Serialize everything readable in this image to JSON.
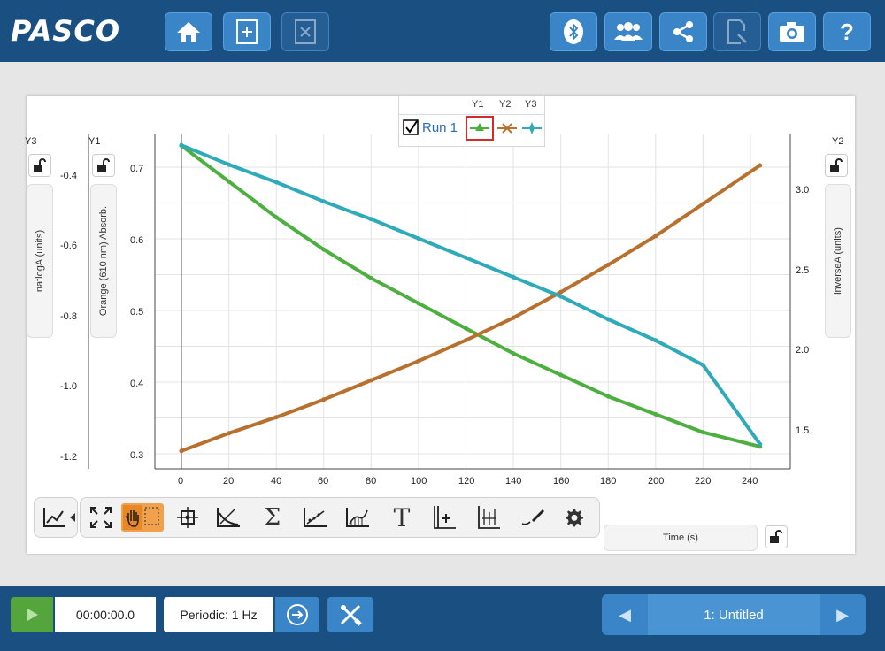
{
  "app": {
    "logo": "PASCO"
  },
  "toolbar_top": {
    "left_buttons": [
      "home-icon",
      "new-file-icon",
      "close-file-icon"
    ],
    "right_buttons": [
      "bluetooth-icon",
      "users-icon",
      "share-icon",
      "export-icon",
      "camera-icon",
      "help-icon"
    ],
    "help_glyph": "?"
  },
  "graph": {
    "legend": {
      "run_label": "Run 1",
      "headers": [
        "Y1",
        "Y2",
        "Y3"
      ],
      "checked": true
    },
    "axes": {
      "y3": {
        "tag": "Y3",
        "label": "natlogA (units)",
        "ticks": [
          "-0.4",
          "-0.6",
          "-0.8",
          "-1.0",
          "-1.2"
        ]
      },
      "y1": {
        "tag": "Y1",
        "label": "Orange (610 nm) Absorb.",
        "ticks": [
          "0.7",
          "0.6",
          "0.5",
          "0.4",
          "0.3"
        ]
      },
      "y2": {
        "tag": "Y2",
        "label": "inverseA (units)",
        "ticks": [
          "3.0",
          "2.5",
          "2.0",
          "1.5"
        ]
      },
      "x": {
        "label": "Time (s)",
        "ticks": [
          "0",
          "20",
          "40",
          "60",
          "80",
          "100",
          "120",
          "140",
          "160",
          "180",
          "200",
          "220",
          "240"
        ]
      }
    },
    "tools": [
      "graph-type-icon",
      "scale-to-fit-icon",
      "select-tool-icon",
      "coordinates-icon",
      "slope-icon",
      "statistics-icon",
      "curve-fit-icon",
      "area-icon",
      "annotation-icon",
      "add-axis-icon",
      "add-plot-icon",
      "draw-prediction-icon",
      "settings-icon"
    ],
    "annotation_glyph": "T",
    "stats_glyph": "Σ"
  },
  "chart_data": {
    "type": "line",
    "x_label": "Time (s)",
    "xlim": [
      0,
      245
    ],
    "series": [
      {
        "name": "Orange (610 nm) Absorb.",
        "axis": "Y1",
        "color": "#4caf3f",
        "x": [
          0,
          20,
          40,
          60,
          80,
          100,
          120,
          140,
          160,
          180,
          200,
          220,
          244
        ],
        "y": [
          0.73,
          0.68,
          0.63,
          0.585,
          0.545,
          0.51,
          0.475,
          0.44,
          0.41,
          0.38,
          0.355,
          0.33,
          0.31
        ]
      },
      {
        "name": "inverseA (units)",
        "axis": "Y2",
        "color": "#b8702e",
        "x": [
          0,
          20,
          40,
          60,
          80,
          100,
          120,
          140,
          160,
          180,
          200,
          220,
          244
        ],
        "y": [
          1.38,
          1.49,
          1.59,
          1.7,
          1.82,
          1.94,
          2.07,
          2.21,
          2.37,
          2.54,
          2.72,
          2.92,
          3.16
        ]
      },
      {
        "name": "natlogA (units)",
        "axis": "Y3",
        "color": "#2eaab9",
        "x": [
          0,
          20,
          40,
          60,
          80,
          100,
          120,
          140,
          160,
          180,
          200,
          220,
          244
        ],
        "y": [
          -0.31,
          -0.365,
          -0.415,
          -0.47,
          -0.52,
          -0.575,
          -0.63,
          -0.685,
          -0.74,
          -0.805,
          -0.865,
          -0.935,
          -1.16
        ]
      }
    ],
    "y1_range": [
      0.29,
      0.76
    ],
    "y2_range": [
      1.3,
      3.35
    ],
    "y3_range": [
      -1.25,
      -0.33
    ],
    "grid": true
  },
  "control_bar": {
    "timer": "00:00:00.0",
    "sample_rate": "Periodic: 1 Hz",
    "page_title": "1: Untitled",
    "prev_glyph": "◀",
    "next_glyph": "▶"
  }
}
